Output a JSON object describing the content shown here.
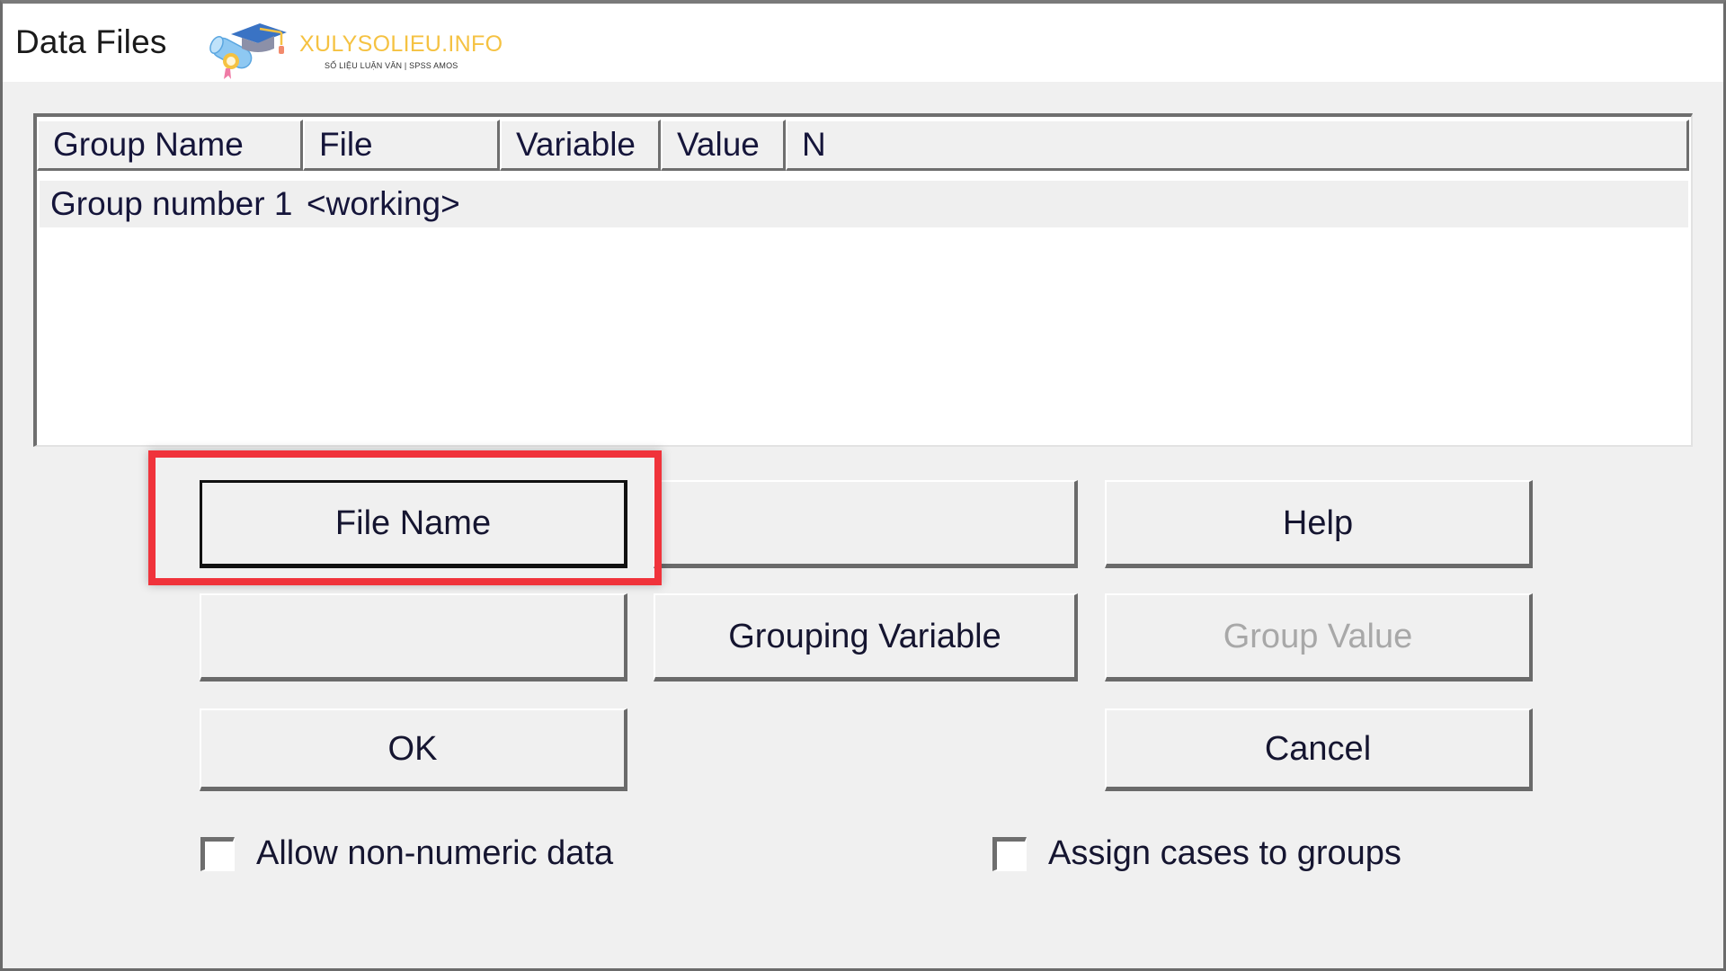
{
  "window": {
    "title": "Data Files",
    "watermark": {
      "brand": "XULYSOLIEU.INFO",
      "tagline": "SỐ LIỆU LUẬN VĂN | SPSS AMOS",
      "brand_color": "#f5c242",
      "icon": "graduation-cap-diploma-logo"
    }
  },
  "groups_table": {
    "columns": [
      "Group Name",
      "File",
      "Variable",
      "Value",
      "N"
    ],
    "rows": [
      {
        "group_name": "Group number 1",
        "file": "<working>",
        "variable": "",
        "value": "",
        "n": ""
      }
    ]
  },
  "buttons": {
    "file_name": "File Name",
    "blank_top": "",
    "help": "Help",
    "blank_middle": "",
    "grouping_variable": "Grouping Variable",
    "group_value": "Group Value",
    "ok": "OK",
    "cancel": "Cancel"
  },
  "options": {
    "allow_non_numeric": {
      "label": "Allow non-numeric data",
      "checked": false
    },
    "assign_cases": {
      "label": "Assign cases to groups",
      "checked": false
    }
  },
  "annotation": {
    "highlight_color": "#f0333b",
    "highlighted_target": "File Name"
  }
}
